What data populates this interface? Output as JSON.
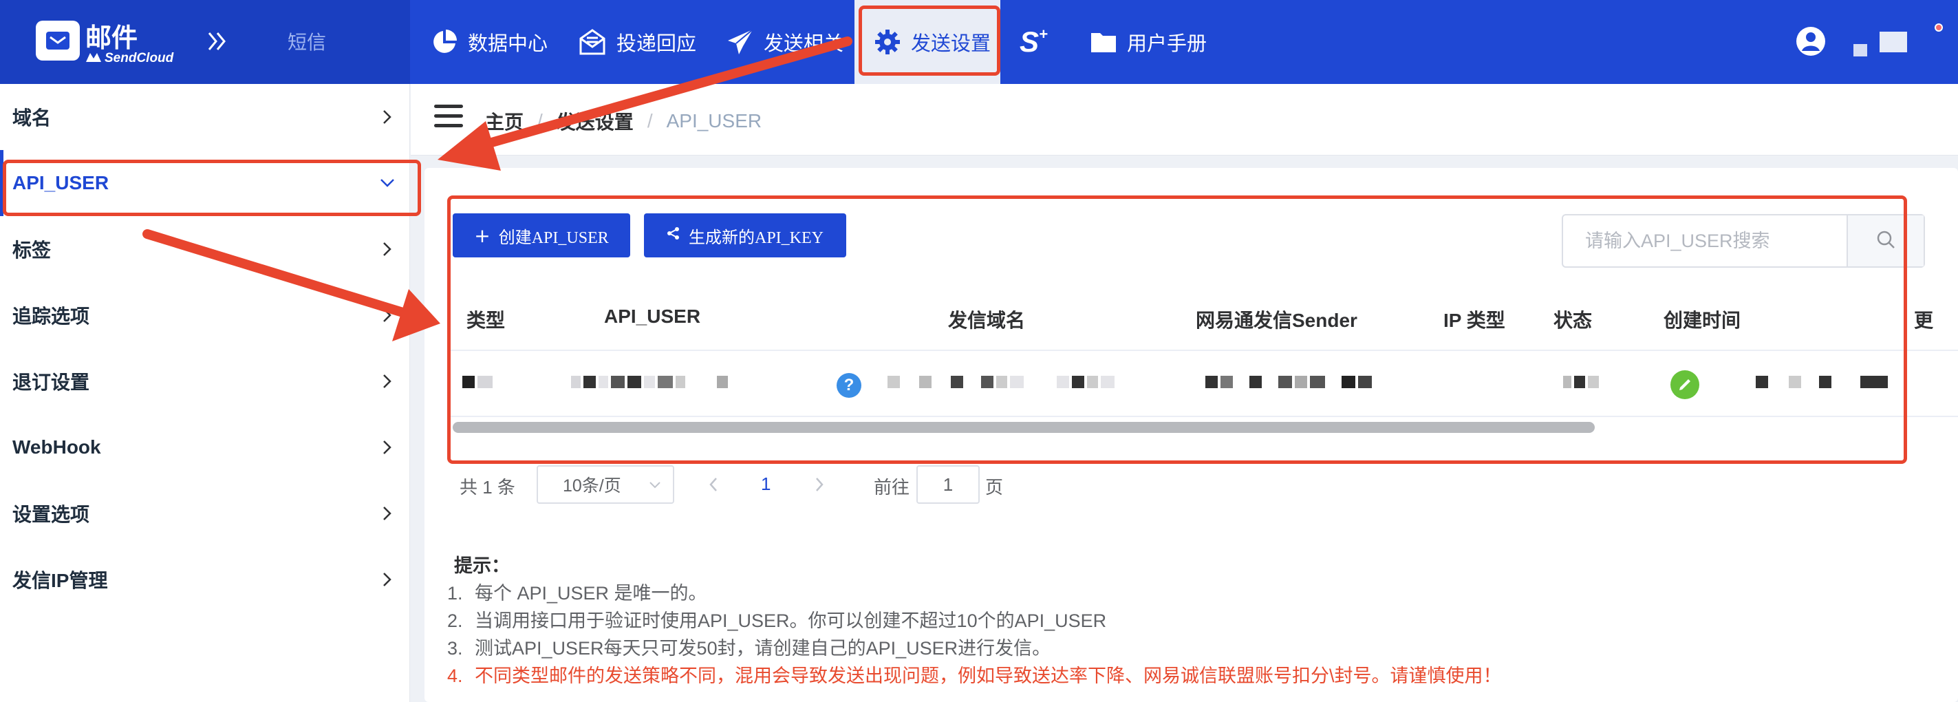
{
  "brand": {
    "title": "邮件",
    "subtitle": "SendCloud"
  },
  "topnav": {
    "sms": "短信",
    "items": [
      {
        "label": "数据中心",
        "icon": "pie-chart-icon"
      },
      {
        "label": "投递回应",
        "icon": "mail-feedback-icon"
      },
      {
        "label": "发送相关",
        "icon": "paper-plane-icon"
      },
      {
        "label": "发送设置",
        "icon": "gear-icon",
        "active": true
      },
      {
        "label": "",
        "icon": "sendcloud-s-plus-icon"
      },
      {
        "label": "用户手册",
        "icon": "folder-icon"
      }
    ]
  },
  "sidebar": {
    "items": [
      {
        "label": "域名"
      },
      {
        "label": "API_USER",
        "active": true
      },
      {
        "label": "标签"
      },
      {
        "label": "追踪选项"
      },
      {
        "label": "退订设置"
      },
      {
        "label": "WebHook"
      },
      {
        "label": "设置选项"
      },
      {
        "label": "发信IP管理"
      }
    ]
  },
  "breadcrumb": {
    "home": "主页",
    "section": "发送设置",
    "sep": "/",
    "current": "API_USER"
  },
  "toolbar": {
    "create_label": "创建API_USER",
    "generate_key_label": "生成新的API_KEY",
    "search_placeholder": "请输入API_USER搜索"
  },
  "table": {
    "headers": [
      "类型",
      "API_USER",
      "发信域名",
      "网易通发信Sender",
      "IP 类型",
      "状态",
      "创建时间",
      "更"
    ]
  },
  "pagination": {
    "total": "共 1 条",
    "page_size": "10条/页",
    "current_page": "1",
    "goto_label": "前往",
    "goto_value": "1",
    "page_unit": "页"
  },
  "tips": {
    "title": "提示：",
    "items": [
      {
        "num": "1.",
        "text": "每个 API_USER 是唯一的。"
      },
      {
        "num": "2.",
        "text": "当调用接口用于验证时使用API_USER。你可以创建不超过10个的API_USER"
      },
      {
        "num": "3.",
        "text": "测试API_USER每天只可发50封，请创建自己的API_USER进行发信。"
      },
      {
        "num": "4.",
        "text": "不同类型邮件的发送策略不同，混用会导致发送出现问题，例如导致送达率下降、网易诚信联盟账号扣分\\封号。请谨慎使用！"
      }
    ]
  },
  "colors": {
    "primary": "#1f48d4",
    "annotation": "#e8452e",
    "success": "#67c23a",
    "warning_text": "#e84b2f"
  }
}
